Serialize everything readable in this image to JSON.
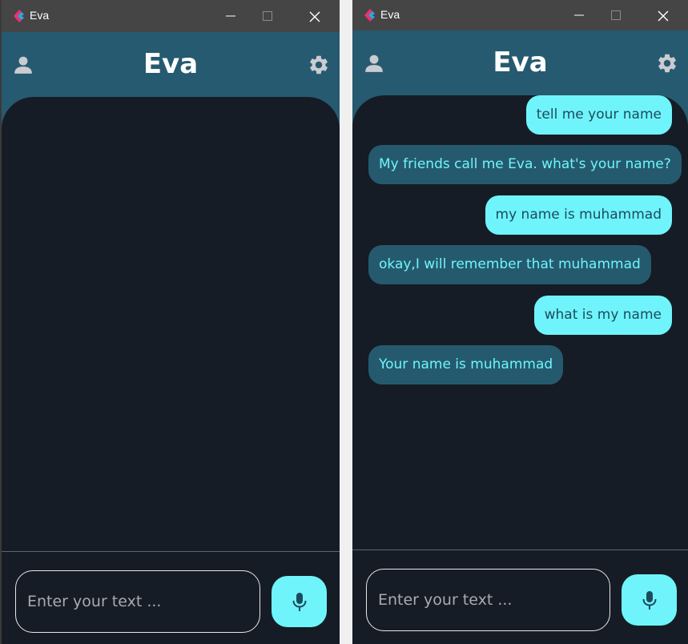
{
  "windows": [
    {
      "titlebar": {
        "title": "Eva"
      },
      "header": {
        "title": "Eva"
      },
      "chat": {
        "messages": []
      },
      "input": {
        "placeholder": "Enter your text ..."
      }
    },
    {
      "titlebar": {
        "title": "Eva"
      },
      "header": {
        "title": "Eva"
      },
      "chat": {
        "messages": [
          {
            "sender": "user",
            "text": "tell me your name"
          },
          {
            "sender": "bot",
            "text": "My friends call me Eva. what's your name?"
          },
          {
            "sender": "user",
            "text": "my name is muhammad"
          },
          {
            "sender": "bot",
            "text": "okay,I will remember that muhammad"
          },
          {
            "sender": "user",
            "text": "what is my name"
          },
          {
            "sender": "bot",
            "text": "Your name is muhammad"
          }
        ]
      },
      "input": {
        "placeholder": "Enter your text ..."
      }
    }
  ],
  "colors": {
    "header": "#265a70",
    "background": "#151c25",
    "user_bubble": "#6ff4fb",
    "bot_bubble": "#255a6e",
    "accent": "#6ff4fb"
  },
  "icons": {
    "app_logo": "flutter-logo-icon",
    "profile": "person-icon",
    "settings": "gear-icon",
    "mic": "microphone-icon",
    "minimize": "minimize-icon",
    "maximize": "maximize-icon",
    "close": "close-icon"
  }
}
